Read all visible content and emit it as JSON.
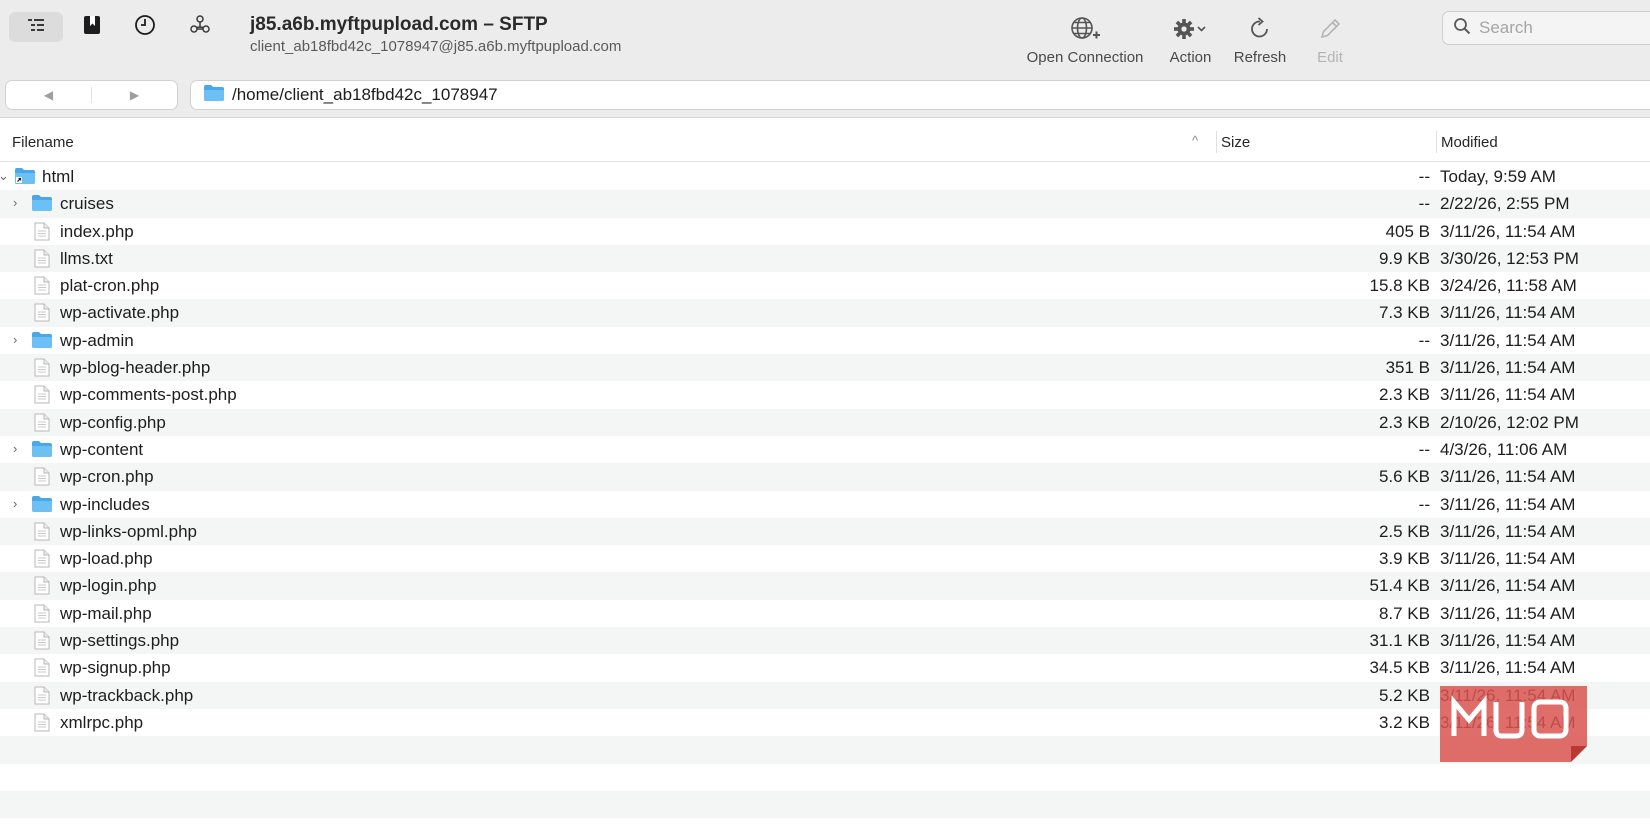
{
  "window": {
    "title": "j85.a6b.myftpupload.com – SFTP",
    "subtitle": "client_ab18fbd42c_1078947@j85.a6b.myftpupload.com"
  },
  "toolbar": {
    "actions": [
      {
        "label": "Open Connection",
        "icon": "globe-plus-icon"
      },
      {
        "label": "Action",
        "icon": "gear-icon"
      },
      {
        "label": "Refresh",
        "icon": "refresh-icon"
      },
      {
        "label": "Edit",
        "icon": "pencil-icon"
      }
    ],
    "search_placeholder": "Search"
  },
  "nav": {
    "back": "◀",
    "forward": "▶",
    "path": "/home/client_ab18fbd42c_1078947"
  },
  "columns": {
    "filename": "Filename",
    "size": "Size",
    "modified": "Modified"
  },
  "files": [
    {
      "name": "html",
      "type": "folder-alias",
      "size": "--",
      "modified": "Today, 9:59 AM",
      "expanded": true
    },
    {
      "name": "cruises",
      "type": "folder",
      "size": "--",
      "modified": "2/22/26, 2:55 PM"
    },
    {
      "name": "index.php",
      "type": "file",
      "size": "405 B",
      "modified": "3/11/26, 11:54 AM"
    },
    {
      "name": "llms.txt",
      "type": "file",
      "size": "9.9 KB",
      "modified": "3/30/26, 12:53 PM"
    },
    {
      "name": "plat-cron.php",
      "type": "file",
      "size": "15.8 KB",
      "modified": "3/24/26, 11:58 AM"
    },
    {
      "name": "wp-activate.php",
      "type": "file",
      "size": "7.3 KB",
      "modified": "3/11/26, 11:54 AM"
    },
    {
      "name": "wp-admin",
      "type": "folder",
      "size": "--",
      "modified": "3/11/26, 11:54 AM"
    },
    {
      "name": "wp-blog-header.php",
      "type": "file",
      "size": "351 B",
      "modified": "3/11/26, 11:54 AM"
    },
    {
      "name": "wp-comments-post.php",
      "type": "file",
      "size": "2.3 KB",
      "modified": "3/11/26, 11:54 AM"
    },
    {
      "name": "wp-config.php",
      "type": "file",
      "size": "2.3 KB",
      "modified": "2/10/26, 12:02 PM"
    },
    {
      "name": "wp-content",
      "type": "folder",
      "size": "--",
      "modified": "4/3/26, 11:06 AM"
    },
    {
      "name": "wp-cron.php",
      "type": "file",
      "size": "5.6 KB",
      "modified": "3/11/26, 11:54 AM"
    },
    {
      "name": "wp-includes",
      "type": "folder",
      "size": "--",
      "modified": "3/11/26, 11:54 AM"
    },
    {
      "name": "wp-links-opml.php",
      "type": "file",
      "size": "2.5 KB",
      "modified": "3/11/26, 11:54 AM"
    },
    {
      "name": "wp-load.php",
      "type": "file",
      "size": "3.9 KB",
      "modified": "3/11/26, 11:54 AM"
    },
    {
      "name": "wp-login.php",
      "type": "file",
      "size": "51.4 KB",
      "modified": "3/11/26, 11:54 AM"
    },
    {
      "name": "wp-mail.php",
      "type": "file",
      "size": "8.7 KB",
      "modified": "3/11/26, 11:54 AM"
    },
    {
      "name": "wp-settings.php",
      "type": "file",
      "size": "31.1 KB",
      "modified": "3/11/26, 11:54 AM"
    },
    {
      "name": "wp-signup.php",
      "type": "file",
      "size": "34.5 KB",
      "modified": "3/11/26, 11:54 AM"
    },
    {
      "name": "wp-trackback.php",
      "type": "file",
      "size": "5.2 KB",
      "modified": "3/11/26, 11:54 AM"
    },
    {
      "name": "xmlrpc.php",
      "type": "file",
      "size": "3.2 KB",
      "modified": "3/11/26, 11:54 AM"
    }
  ],
  "watermark": "MUO",
  "colors": {
    "folder": "#5fb6ee",
    "alt_row": "#f4f5f5",
    "toolbar_bg": "#ececec",
    "watermark": "#d9534f"
  }
}
